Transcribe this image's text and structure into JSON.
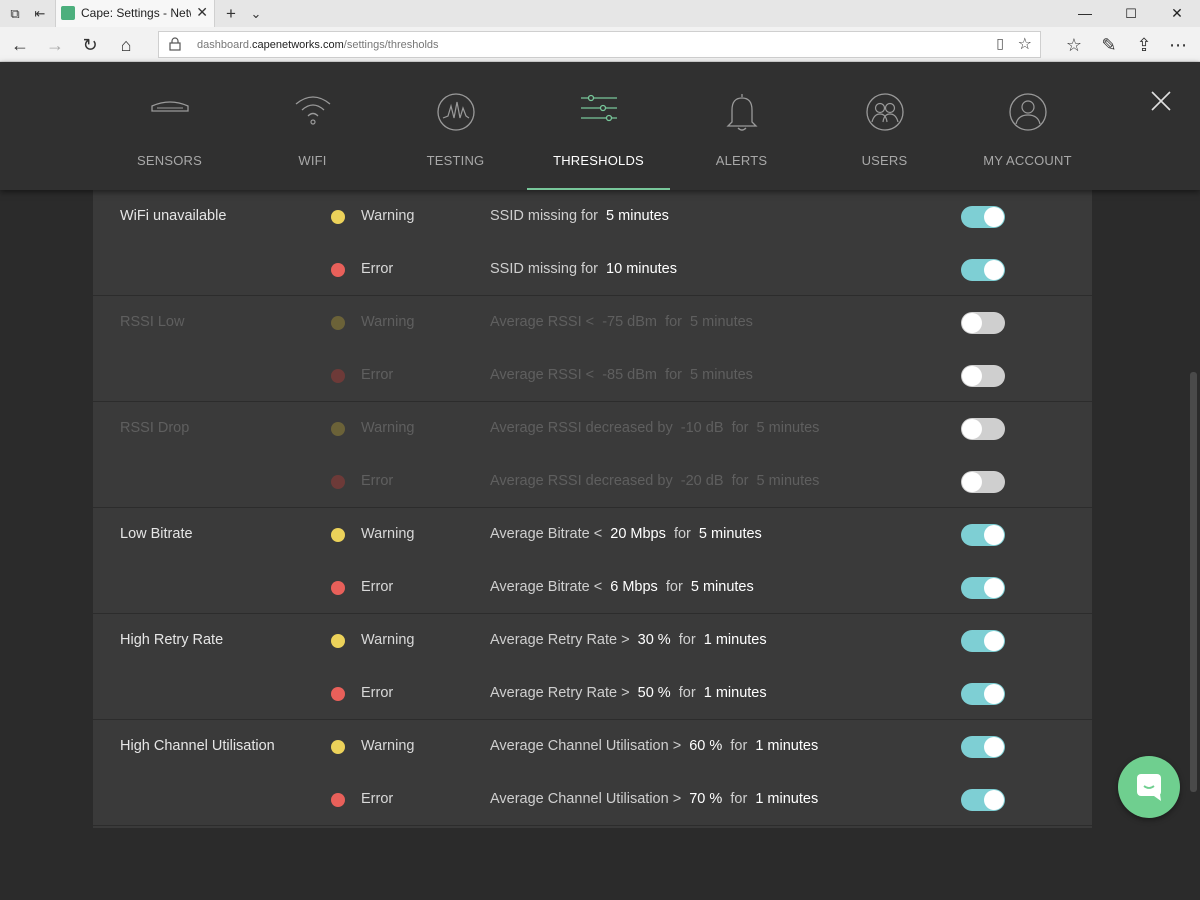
{
  "browser": {
    "tab_title": "Cape: Settings - Networ",
    "url_prefix": "dashboard.",
    "url_domain": "capenetworks.com",
    "url_path": "/settings/thresholds"
  },
  "nav": {
    "items": [
      {
        "label": "SENSORS",
        "icon": "router-icon"
      },
      {
        "label": "WIFI",
        "icon": "wifi-icon"
      },
      {
        "label": "TESTING",
        "icon": "waveform-icon"
      },
      {
        "label": "THRESHOLDS",
        "icon": "sliders-icon",
        "active": true
      },
      {
        "label": "ALERTS",
        "icon": "bell-icon"
      },
      {
        "label": "USERS",
        "icon": "users-icon"
      },
      {
        "label": "MY ACCOUNT",
        "icon": "account-icon"
      }
    ]
  },
  "colors": {
    "accent": "#78c79a",
    "toggle_on": "#7ecfd4",
    "warning": "#ecd25a",
    "error": "#e8605a"
  },
  "thresholds": [
    {
      "name": "WiFi unavailable",
      "enabled": true,
      "rows": [
        {
          "severity": "Warning",
          "pre": "SSID missing for",
          "value": "5 minutes",
          "mid": "",
          "duration": "",
          "on": true
        },
        {
          "severity": "Error",
          "pre": "SSID missing for",
          "value": "10 minutes",
          "mid": "",
          "duration": "",
          "on": true
        }
      ]
    },
    {
      "name": "RSSI Low",
      "enabled": false,
      "rows": [
        {
          "severity": "Warning",
          "pre": "Average RSSI <",
          "value": "-75 dBm",
          "mid": "for",
          "duration": "5 minutes",
          "on": false
        },
        {
          "severity": "Error",
          "pre": "Average RSSI <",
          "value": "-85 dBm",
          "mid": "for",
          "duration": "5 minutes",
          "on": false
        }
      ]
    },
    {
      "name": "RSSI Drop",
      "enabled": false,
      "rows": [
        {
          "severity": "Warning",
          "pre": "Average RSSI decreased by",
          "value": "-10 dB",
          "mid": "for",
          "duration": "5 minutes",
          "on": false
        },
        {
          "severity": "Error",
          "pre": "Average RSSI decreased by",
          "value": "-20 dB",
          "mid": "for",
          "duration": "5 minutes",
          "on": false
        }
      ]
    },
    {
      "name": "Low Bitrate",
      "enabled": true,
      "rows": [
        {
          "severity": "Warning",
          "pre": "Average Bitrate <",
          "value": "20 Mbps",
          "mid": "for",
          "duration": "5 minutes",
          "on": true
        },
        {
          "severity": "Error",
          "pre": "Average Bitrate <",
          "value": "6 Mbps",
          "mid": "for",
          "duration": "5 minutes",
          "on": true
        }
      ]
    },
    {
      "name": "High Retry Rate",
      "enabled": true,
      "rows": [
        {
          "severity": "Warning",
          "pre": "Average Retry Rate >",
          "value": "30 %",
          "mid": "for",
          "duration": "1 minutes",
          "on": true
        },
        {
          "severity": "Error",
          "pre": "Average Retry Rate >",
          "value": "50 %",
          "mid": "for",
          "duration": "1 minutes",
          "on": true
        }
      ]
    },
    {
      "name": "High Channel Utilisation",
      "enabled": true,
      "rows": [
        {
          "severity": "Warning",
          "pre": "Average Channel Utilisation >",
          "value": "60 %",
          "mid": "for",
          "duration": "1 minutes",
          "on": true
        },
        {
          "severity": "Error",
          "pre": "Average Channel Utilisation >",
          "value": "70 %",
          "mid": "for",
          "duration": "1 minutes",
          "on": true
        }
      ]
    }
  ]
}
